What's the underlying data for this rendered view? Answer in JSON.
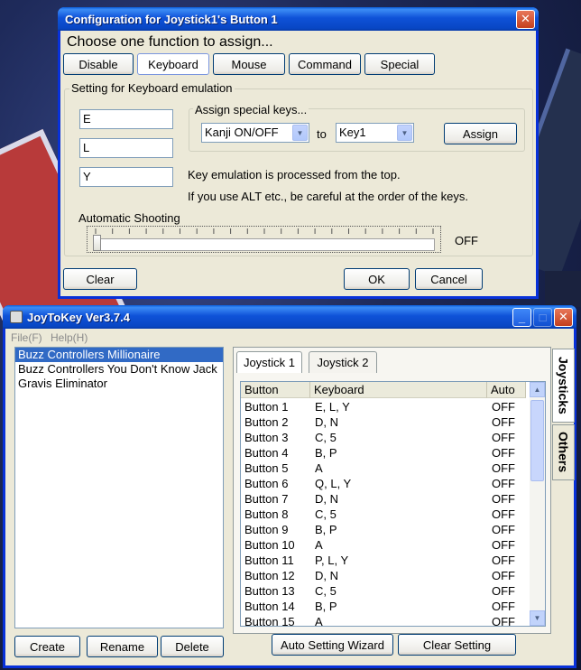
{
  "config_dialog": {
    "title": "Configuration for Joystick1's Button 1",
    "heading": "Choose one function to assign...",
    "tabs": [
      "Disable",
      "Keyboard",
      "Mouse",
      "Command",
      "Special"
    ],
    "active_tab": "Keyboard",
    "group_label": "Setting for Keyboard emulation",
    "key_fields": [
      "E",
      "L",
      "Y"
    ],
    "special_keys_label": "Assign special keys...",
    "special_from": "Kanji ON/OFF",
    "to_label": "to",
    "special_to": "Key1",
    "assign_button": "Assign",
    "note1": "Key emulation is processed from the top.",
    "note2": "If you use ALT etc., be careful at the order of the keys.",
    "auto_shooting_label": "Automatic Shooting",
    "auto_shooting_value": "OFF",
    "auto_shooting_level": 0,
    "clear_button": "Clear",
    "ok_button": "OK",
    "cancel_button": "Cancel"
  },
  "main_window": {
    "title": "JoyToKey Ver3.7.4",
    "menu": [
      "File(F)",
      "Help(H)"
    ],
    "profiles": [
      "Buzz Controllers Millionaire",
      "Buzz Controllers You Don't Know Jack",
      "Gravis Eliminator"
    ],
    "selected_profile": "Buzz Controllers Millionaire",
    "create_button": "Create",
    "rename_button": "Rename",
    "delete_button": "Delete",
    "joystick_tabs": [
      "Joystick 1",
      "Joystick 2"
    ],
    "side_tabs": [
      "Joysticks",
      "Others"
    ],
    "columns": [
      "Button",
      "Keyboard",
      "Auto"
    ],
    "rows": [
      {
        "button": "Button 1",
        "keyboard": "E, L, Y",
        "auto": "OFF"
      },
      {
        "button": "Button 2",
        "keyboard": "D, N",
        "auto": "OFF"
      },
      {
        "button": "Button 3",
        "keyboard": "C, 5",
        "auto": "OFF"
      },
      {
        "button": "Button 4",
        "keyboard": "B, P",
        "auto": "OFF"
      },
      {
        "button": "Button 5",
        "keyboard": "A",
        "auto": "OFF"
      },
      {
        "button": "Button 6",
        "keyboard": "Q, L, Y",
        "auto": "OFF"
      },
      {
        "button": "Button 7",
        "keyboard": "D, N",
        "auto": "OFF"
      },
      {
        "button": "Button 8",
        "keyboard": "C, 5",
        "auto": "OFF"
      },
      {
        "button": "Button 9",
        "keyboard": "B, P",
        "auto": "OFF"
      },
      {
        "button": "Button 10",
        "keyboard": "A",
        "auto": "OFF"
      },
      {
        "button": "Button 11",
        "keyboard": "P, L, Y",
        "auto": "OFF"
      },
      {
        "button": "Button 12",
        "keyboard": "D, N",
        "auto": "OFF"
      },
      {
        "button": "Button 13",
        "keyboard": "C, 5",
        "auto": "OFF"
      },
      {
        "button": "Button 14",
        "keyboard": "B, P",
        "auto": "OFF"
      },
      {
        "button": "Button 15",
        "keyboard": "A",
        "auto": "OFF"
      }
    ],
    "auto_setting_button": "Auto Setting Wizard",
    "clear_setting_button": "Clear Setting"
  }
}
